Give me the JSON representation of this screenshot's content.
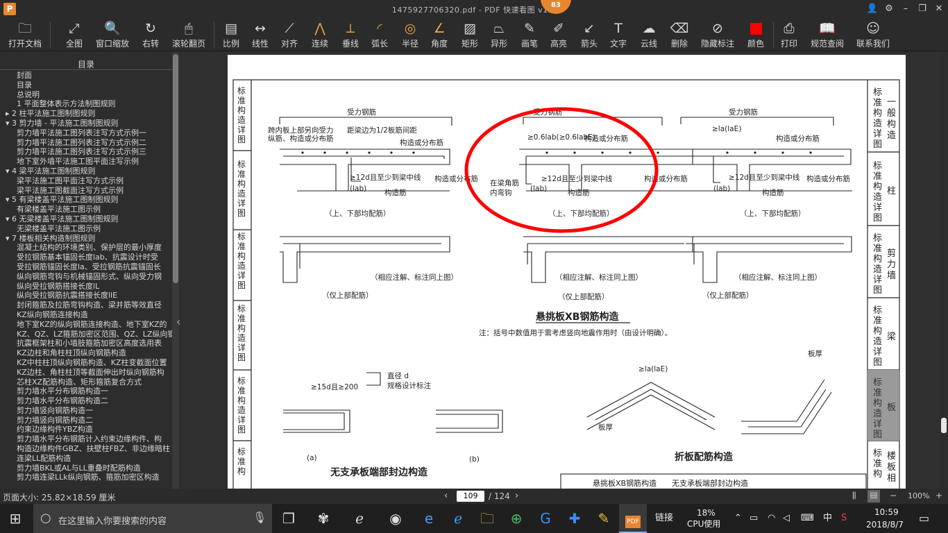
{
  "window": {
    "title": "1475927706320.pdf - PDF 快速看图 v1.9",
    "app_icon": "P",
    "badge": "83"
  },
  "toolbar": {
    "items": [
      {
        "label": "打开文档",
        "icon": "folder-icon"
      },
      {
        "label": "全图",
        "icon": "fit-icon"
      },
      {
        "label": "窗口缩放",
        "icon": "zoom-icon"
      },
      {
        "label": "右转",
        "icon": "rotate-icon"
      },
      {
        "label": "滚轮翻页",
        "icon": "mouse-icon"
      },
      {
        "label": "比例",
        "icon": "scale-icon"
      },
      {
        "label": "线性",
        "icon": "linear-icon"
      },
      {
        "label": "对齐",
        "icon": "align-icon"
      },
      {
        "label": "连续",
        "icon": "continuous-icon"
      },
      {
        "label": "垂线",
        "icon": "perpendicular-icon"
      },
      {
        "label": "弧长",
        "icon": "arc-icon"
      },
      {
        "label": "半径",
        "icon": "radius-icon"
      },
      {
        "label": "角度",
        "icon": "angle-icon"
      },
      {
        "label": "矩形",
        "icon": "rect-icon"
      },
      {
        "label": "异形",
        "icon": "polygon-icon"
      },
      {
        "label": "画笔",
        "icon": "pen-icon"
      },
      {
        "label": "高亮",
        "icon": "highlight-icon"
      },
      {
        "label": "箭头",
        "icon": "arrow-icon"
      },
      {
        "label": "文字",
        "icon": "text-icon"
      },
      {
        "label": "云线",
        "icon": "cloud-icon"
      },
      {
        "label": "删除",
        "icon": "eraser-icon"
      },
      {
        "label": "隐藏标注",
        "icon": "hide-icon"
      },
      {
        "label": "颜色",
        "icon": "color-icon",
        "color": "#ff0000"
      },
      {
        "label": "打印",
        "icon": "print-icon"
      },
      {
        "label": "规范查阅",
        "icon": "book-icon"
      },
      {
        "label": "联系我们",
        "icon": "contact-icon"
      }
    ]
  },
  "sidebar": {
    "header": "目录",
    "items": [
      "封面",
      "目录",
      "总说明",
      "1 平面整体表示方法制图规则",
      "▸ 2 柱平法施工图制图规则",
      "▾ 3 剪力墙 - 平法施工图制图规则",
      "剪力墙平法施工图列表注写方式示例一",
      "剪力墙平法施工图列表注写方式示例二",
      "剪力墙平法施工图列表注写方式示例三",
      "地下室外墙平法施工图平面注写示例",
      "▾ 4 梁平法施工图制图规则",
      "梁平法施工图平面注写方式示例",
      "梁平法施工图截面注写方式示例",
      "▾ 5 有梁楼盖平法施工图制图规则",
      "有梁楼盖平法施工图示例",
      "▾ 6 无梁楼盖平法施工图制图规则",
      "无梁楼盖平法施工图示例",
      "▾ 7 楼板相关构造制图规则",
      "混凝土结构的环境类别、保护层的最小厚度",
      "受拉钢筋基本锚固长度lab、抗震设计时受",
      "受拉钢筋锚固长度la、受拉钢筋抗震锚固长",
      "纵向钢筋弯钩与机械锚固形式、纵向受力钢",
      "纵向受拉钢筋搭接长度lL",
      "纵向受拉钢筋抗震搭接长度llE",
      "封闭箍筋及拉筋弯钩构造、梁并筋等效直径",
      "KZ纵向钢筋连接构造",
      "地下室KZ的纵向钢筋连接构造、地下室KZ的",
      "KZ、QZ、LZ箍筋加密区范围、QZ、LZ纵向钢",
      "抗震框架柱和小墙肢箍筋加密区高度选用表",
      "KZ边柱和角柱柱顶纵向钢筋构造",
      "KZ中柱柱顶纵向钢筋构造、KZ柱变截面位置",
      "KZ边柱、角柱柱顶等截面伸出时纵向钢筋构",
      "芯柱XZ配筋构造、矩形箍筋复合方式",
      "剪力墙水平分布钢筋构造一",
      "剪力墙水平分布钢筋构造二",
      "剪力墙竖向钢筋构造一",
      "剪力墙竖向钢筋构造二",
      "约束边缘构件YBZ构造",
      "剪力墙水平分布钢筋计入约束边缘构件、构",
      "构造边缘构件GBZ、扶壁柱FBZ、非边缘暗柱",
      "连梁LL配筋构造",
      "剪力墙BKL或AL与LL重叠时配筋构造",
      "剪力墙连梁LLk纵向钢筋、箍筋加密区构造"
    ]
  },
  "status": {
    "page_size": "页面大小: 25.82×18.59 厘米",
    "current_page": "109",
    "total_pages": "/ 124",
    "zoom": "100%"
  },
  "drawing": {
    "left_tabs": [
      "标准构造详图",
      "一般构造详图",
      "标准构造详图",
      "剪力墙构造详图",
      "标准构造详图",
      "梁构造详图",
      "标准构造详图",
      "板构造详图",
      "标准构造详图",
      "楼板相关构造"
    ],
    "right_tabs": [
      {
        "a": "标准构造详图",
        "b": "一般构造"
      },
      {
        "a": "标准构造详图",
        "b": "柱"
      },
      {
        "a": "标准构造详图",
        "b": "剪力墙"
      },
      {
        "a": "标准构造详图",
        "b": "梁"
      },
      {
        "a": "标准构造详图",
        "b": "板"
      },
      {
        "a": "标准构造",
        "b": "楼板相关"
      }
    ],
    "labels": {
      "force_bar": "受力钢筋",
      "side1": "跨内板上部另向受力纵筋、构造或分布筋",
      "half_spacing": "距梁边为1/2板筋间距",
      "dist": "构造或分布筋",
      "lab_note": "≥12d且至少到梁中线",
      "lab": "(lab)",
      "struct": "构造筋",
      "both": "（上、下部均配筋）",
      "top_only": "（仅上部配筋）",
      "same": "（相应注解、标注同上图）",
      "title1": "悬挑板XB钢筋构造",
      "note1": "注：括号中数值用于需考虑竖向地震作用时（由设计明确）。",
      "corner": "在梁角筋内弯钩",
      "dim06": "≥0.6lab(≥0.6labE)",
      "dim_la": "≥la(laE)",
      "dim15": "≥15d且≥200",
      "dia": "直径 d",
      "dia2": "规格设计标注",
      "thick": "板厚",
      "a": "(a)",
      "b": "(b)",
      "title2": "无支承板端部封边构造",
      "title3": "折板配筋构造",
      "bottom1": "悬挑板XB钢筋构造",
      "bottom2": "无支承板端部封边构造"
    }
  },
  "taskbar": {
    "search_placeholder": "在这里输入你要搜索的内容",
    "cpu_pct": "18%",
    "cpu_label": "CPU使用",
    "link": "链接",
    "ime": "中",
    "time": "10:59",
    "date": "2018/8/7"
  }
}
